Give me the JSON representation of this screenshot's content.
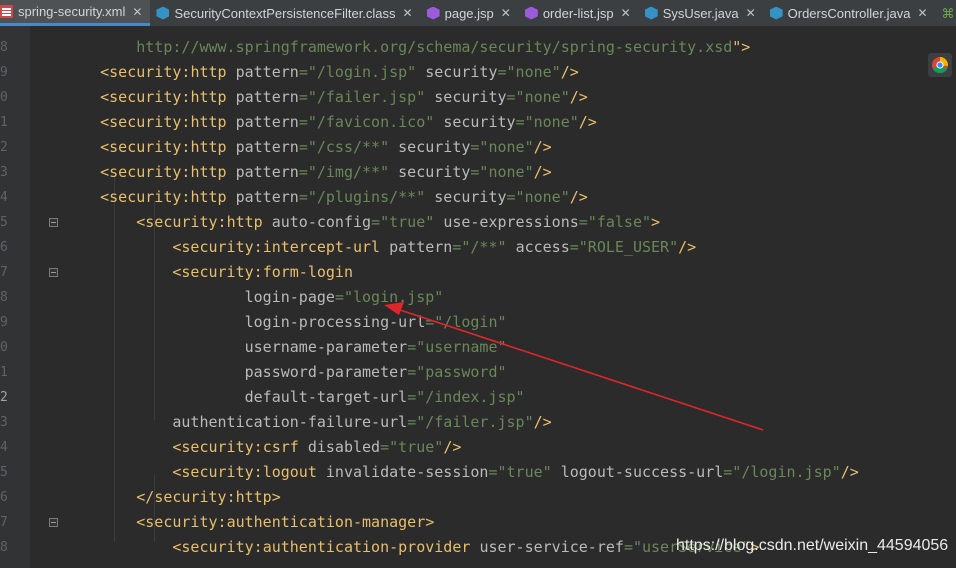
{
  "tabs": [
    {
      "label": "spring-security.xml",
      "icon": "xml-file-icon",
      "active": true
    },
    {
      "label": "SecurityContextPersistenceFilter.class",
      "icon": "class-file-icon",
      "active": false
    },
    {
      "label": "page.jsp",
      "icon": "jsp-file-icon",
      "active": false
    },
    {
      "label": "order-list.jsp",
      "icon": "jsp-file-icon",
      "active": false
    },
    {
      "label": "SysUser.java",
      "icon": "java-class-icon",
      "active": false
    },
    {
      "label": "OrdersController.java",
      "icon": "java-class-icon",
      "active": false
    }
  ],
  "line_numbers": [
    "8",
    "9",
    "0",
    "1",
    "2",
    "3",
    "4",
    "5",
    "6",
    "7",
    "8",
    "9",
    "0",
    "1",
    "2",
    "3",
    "4",
    "5",
    "6",
    "7",
    "8"
  ],
  "code_lines": [
    [
      {
        "t": "        "
      },
      {
        "t": "http://www.springframework.org/schema/security/spring-security.xsd",
        "c": "val"
      },
      {
        "t": "\">",
        "c": "tag"
      }
    ],
    [
      {
        "t": "    "
      },
      {
        "t": "<",
        "c": "tag"
      },
      {
        "t": "security",
        "c": "ns"
      },
      {
        "t": ":",
        "c": "tag"
      },
      {
        "t": "http ",
        "c": "tag"
      },
      {
        "t": "pattern",
        "c": "attr"
      },
      {
        "t": "=\"/login.jsp\"",
        "c": "val"
      },
      {
        "t": " "
      },
      {
        "t": "security",
        "c": "attr"
      },
      {
        "t": "=\"none\"",
        "c": "val"
      },
      {
        "t": "/>",
        "c": "tag"
      }
    ],
    [
      {
        "t": "    "
      },
      {
        "t": "<",
        "c": "tag"
      },
      {
        "t": "security",
        "c": "ns"
      },
      {
        "t": ":",
        "c": "tag"
      },
      {
        "t": "http ",
        "c": "tag"
      },
      {
        "t": "pattern",
        "c": "attr"
      },
      {
        "t": "=\"/failer.jsp\"",
        "c": "val"
      },
      {
        "t": " "
      },
      {
        "t": "security",
        "c": "attr"
      },
      {
        "t": "=\"none\"",
        "c": "val"
      },
      {
        "t": "/>",
        "c": "tag"
      }
    ],
    [
      {
        "t": "    "
      },
      {
        "t": "<",
        "c": "tag"
      },
      {
        "t": "security",
        "c": "ns"
      },
      {
        "t": ":",
        "c": "tag"
      },
      {
        "t": "http ",
        "c": "tag"
      },
      {
        "t": "pattern",
        "c": "attr"
      },
      {
        "t": "=\"/favicon.ico\"",
        "c": "val"
      },
      {
        "t": " "
      },
      {
        "t": "security",
        "c": "attr"
      },
      {
        "t": "=\"none\"",
        "c": "val"
      },
      {
        "t": "/>",
        "c": "tag"
      }
    ],
    [
      {
        "t": "    "
      },
      {
        "t": "<",
        "c": "tag"
      },
      {
        "t": "security",
        "c": "ns"
      },
      {
        "t": ":",
        "c": "tag"
      },
      {
        "t": "http ",
        "c": "tag"
      },
      {
        "t": "pattern",
        "c": "attr"
      },
      {
        "t": "=\"/css/**\"",
        "c": "val"
      },
      {
        "t": " "
      },
      {
        "t": "security",
        "c": "attr"
      },
      {
        "t": "=\"none\"",
        "c": "val"
      },
      {
        "t": "/>",
        "c": "tag"
      }
    ],
    [
      {
        "t": "    "
      },
      {
        "t": "<",
        "c": "tag"
      },
      {
        "t": "security",
        "c": "ns"
      },
      {
        "t": ":",
        "c": "tag"
      },
      {
        "t": "http ",
        "c": "tag"
      },
      {
        "t": "pattern",
        "c": "attr"
      },
      {
        "t": "=\"/img/**\"",
        "c": "val"
      },
      {
        "t": " "
      },
      {
        "t": "security",
        "c": "attr"
      },
      {
        "t": "=\"none\"",
        "c": "val"
      },
      {
        "t": "/>",
        "c": "tag"
      }
    ],
    [
      {
        "t": "    "
      },
      {
        "t": "<",
        "c": "tag"
      },
      {
        "t": "security",
        "c": "ns"
      },
      {
        "t": ":",
        "c": "tag"
      },
      {
        "t": "http ",
        "c": "tag"
      },
      {
        "t": "pattern",
        "c": "attr"
      },
      {
        "t": "=\"/plugins/**\"",
        "c": "val"
      },
      {
        "t": " "
      },
      {
        "t": "security",
        "c": "attr"
      },
      {
        "t": "=\"none\"",
        "c": "val"
      },
      {
        "t": "/>",
        "c": "tag"
      }
    ],
    [
      {
        "t": "        "
      },
      {
        "t": "<",
        "c": "tag"
      },
      {
        "t": "security",
        "c": "ns"
      },
      {
        "t": ":",
        "c": "tag"
      },
      {
        "t": "http ",
        "c": "tag"
      },
      {
        "t": "auto-config",
        "c": "attr"
      },
      {
        "t": "=\"true\"",
        "c": "val"
      },
      {
        "t": " "
      },
      {
        "t": "use-expressions",
        "c": "attr"
      },
      {
        "t": "=\"false\"",
        "c": "val"
      },
      {
        "t": ">",
        "c": "tag"
      }
    ],
    [
      {
        "t": "            "
      },
      {
        "t": "<",
        "c": "tag"
      },
      {
        "t": "security",
        "c": "ns"
      },
      {
        "t": ":",
        "c": "tag"
      },
      {
        "t": "intercept-url ",
        "c": "tag"
      },
      {
        "t": "pattern",
        "c": "attr"
      },
      {
        "t": "=\"/**\"",
        "c": "val"
      },
      {
        "t": " "
      },
      {
        "t": "access",
        "c": "attr"
      },
      {
        "t": "=\"ROLE_USER\"",
        "c": "val"
      },
      {
        "t": "/>",
        "c": "tag"
      }
    ],
    [
      {
        "t": "            "
      },
      {
        "t": "<",
        "c": "tag"
      },
      {
        "t": "security",
        "c": "ns"
      },
      {
        "t": ":",
        "c": "tag"
      },
      {
        "t": "form-login",
        "c": "tag"
      }
    ],
    [
      {
        "t": "                    "
      },
      {
        "t": "login-page",
        "c": "attr"
      },
      {
        "t": "=\"login.jsp\"",
        "c": "val"
      }
    ],
    [
      {
        "t": "                    "
      },
      {
        "t": "login-processing-url",
        "c": "attr"
      },
      {
        "t": "=\"/login\"",
        "c": "val"
      }
    ],
    [
      {
        "t": "                    "
      },
      {
        "t": "username-parameter",
        "c": "attr"
      },
      {
        "t": "=\"username\"",
        "c": "val"
      }
    ],
    [
      {
        "t": "                    "
      },
      {
        "t": "password-parameter",
        "c": "attr"
      },
      {
        "t": "=\"password\"",
        "c": "val"
      }
    ],
    [
      {
        "t": "                    "
      },
      {
        "t": "default-target-url",
        "c": "attr"
      },
      {
        "t": "=\"/index.jsp\"",
        "c": "val"
      }
    ],
    [
      {
        "t": "            "
      },
      {
        "t": "authentication-failure-url",
        "c": "attr"
      },
      {
        "t": "=\"/failer.jsp\"",
        "c": "val"
      },
      {
        "t": "/>",
        "c": "tag"
      }
    ],
    [
      {
        "t": "            "
      },
      {
        "t": "<",
        "c": "tag"
      },
      {
        "t": "security",
        "c": "ns"
      },
      {
        "t": ":",
        "c": "tag"
      },
      {
        "t": "csrf ",
        "c": "tag"
      },
      {
        "t": "disabled",
        "c": "attr"
      },
      {
        "t": "=\"true\"",
        "c": "val"
      },
      {
        "t": "/>",
        "c": "tag"
      }
    ],
    [
      {
        "t": "            "
      },
      {
        "t": "<",
        "c": "tag"
      },
      {
        "t": "security",
        "c": "ns"
      },
      {
        "t": ":",
        "c": "tag"
      },
      {
        "t": "logout ",
        "c": "tag"
      },
      {
        "t": "invalidate-session",
        "c": "attr"
      },
      {
        "t": "=\"true\"",
        "c": "val"
      },
      {
        "t": " "
      },
      {
        "t": "logout-success-url",
        "c": "attr"
      },
      {
        "t": "=\"/login.jsp\"",
        "c": "val"
      },
      {
        "t": "/>",
        "c": "tag"
      }
    ],
    [
      {
        "t": "        "
      },
      {
        "t": "</",
        "c": "tag"
      },
      {
        "t": "security",
        "c": "ns"
      },
      {
        "t": ":",
        "c": "tag"
      },
      {
        "t": "http",
        "c": "tag"
      },
      {
        "t": ">",
        "c": "tag"
      }
    ],
    [
      {
        "t": "        "
      },
      {
        "t": "<",
        "c": "tag"
      },
      {
        "t": "security",
        "c": "ns"
      },
      {
        "t": ":",
        "c": "tag"
      },
      {
        "t": "authentication-manager",
        "c": "tag"
      },
      {
        "t": ">",
        "c": "tag"
      }
    ],
    [
      {
        "t": "            "
      },
      {
        "t": "<",
        "c": "tag"
      },
      {
        "t": "security",
        "c": "ns"
      },
      {
        "t": ":",
        "c": "tag"
      },
      {
        "t": "authentication-provider ",
        "c": "tag"
      },
      {
        "t": "user-service-ref",
        "c": "attr"
      },
      {
        "t": "=\"userService\"",
        "c": "val"
      },
      {
        "t": ">",
        "c": "tag"
      }
    ]
  ],
  "current_line_index": 14,
  "watermark": "https://blog.csdn.net/weixin_44594056",
  "colors": {
    "tag": "#e8bf6a",
    "attr": "#bababa",
    "value": "#6a8759",
    "background": "#2b2b2b",
    "annotation_arrow": "#e0262b"
  }
}
